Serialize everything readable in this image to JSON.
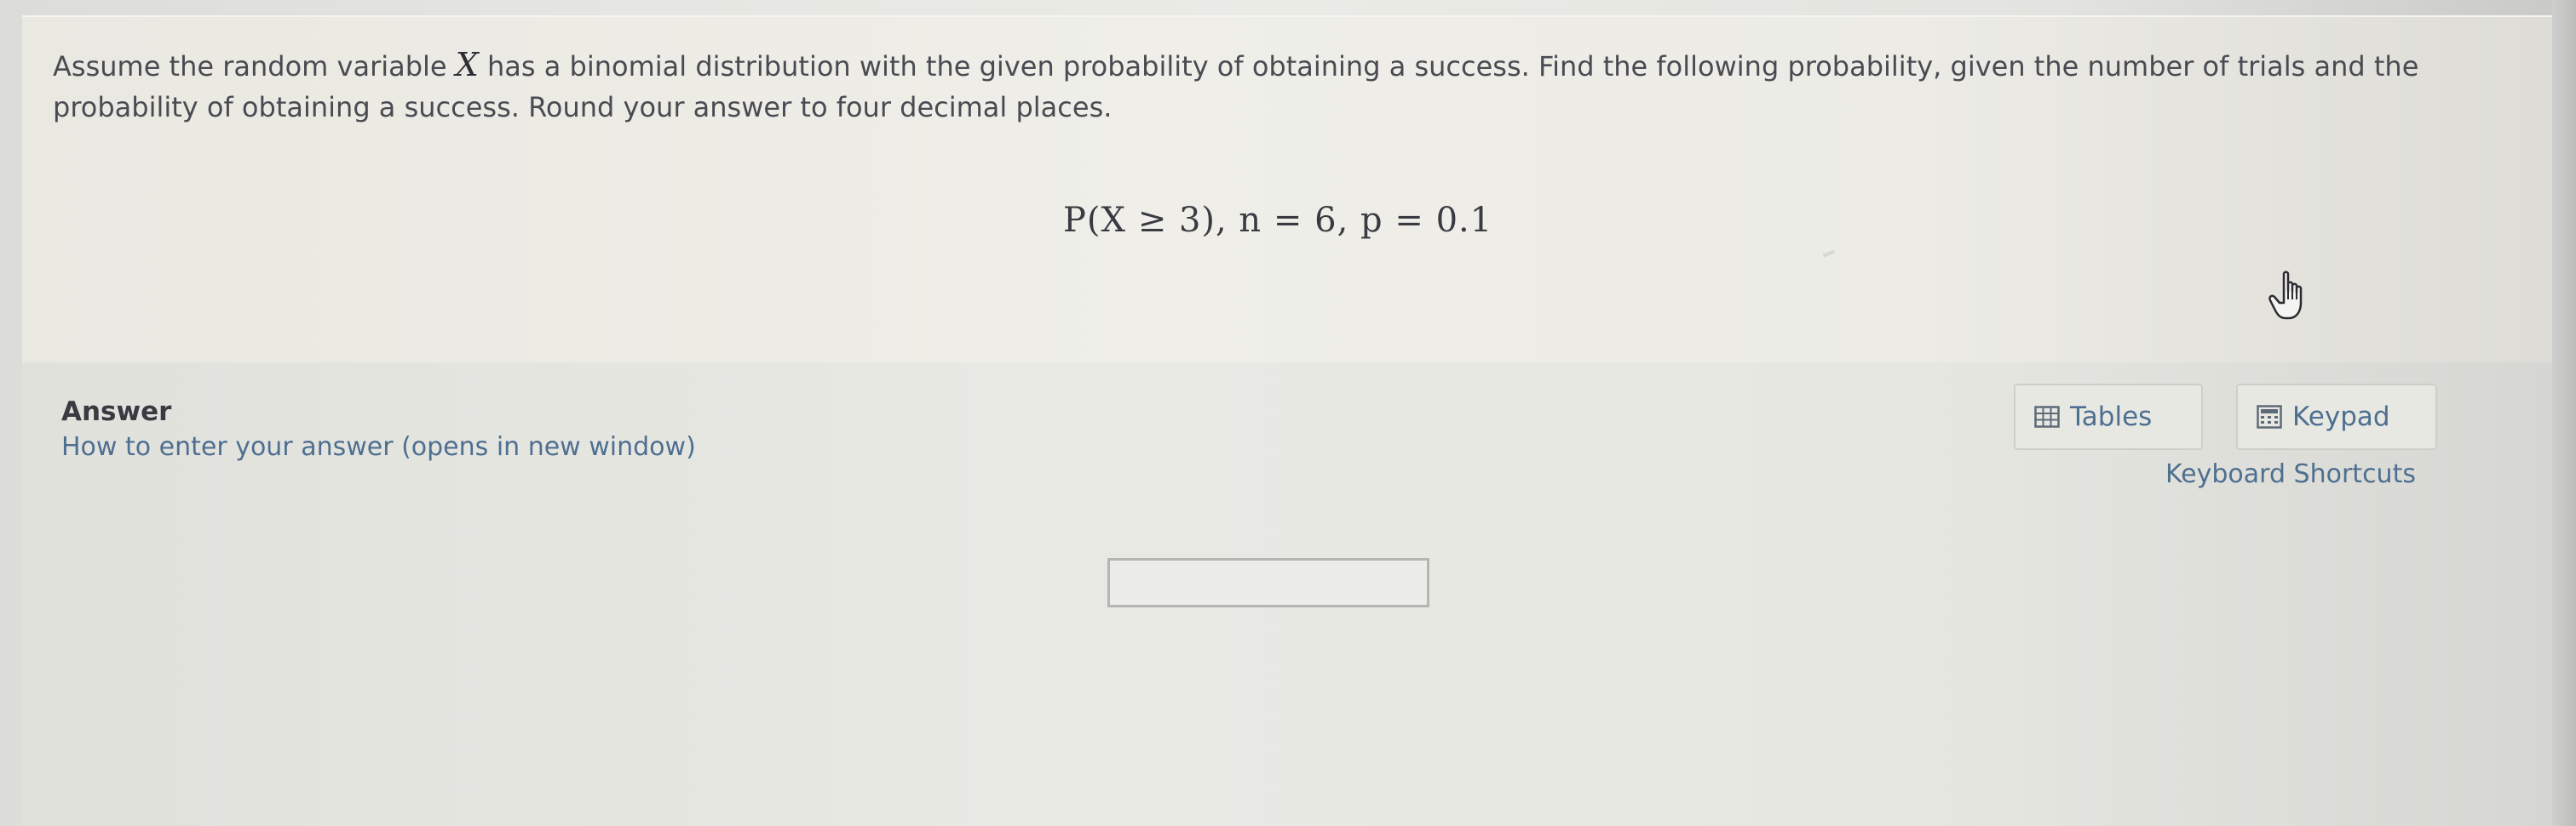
{
  "question": {
    "text_before": "Assume the random variable ",
    "variable": "X",
    "text_after": " has a binomial distribution with the given probability of obtaining a success. Find the following probability, given the number of trials and the probability of obtaining a success. Round your answer to four decimal places.",
    "formula": "P(X ≥ 3), n = 6, p = 0.1"
  },
  "answer": {
    "label": "Answer",
    "help_link": "How to enter your answer (opens in new window)",
    "input_value": "",
    "input_placeholder": ""
  },
  "tools": {
    "tables_label": "Tables",
    "keypad_label": "Keypad",
    "shortcuts_label": "Keyboard Shortcuts"
  },
  "colors": {
    "link": "#4e6f90",
    "text": "#4a4b52"
  },
  "icons": {
    "tables": "table-grid-icon",
    "keypad": "calculator-icon",
    "cursor": "hand-pointer-icon"
  }
}
